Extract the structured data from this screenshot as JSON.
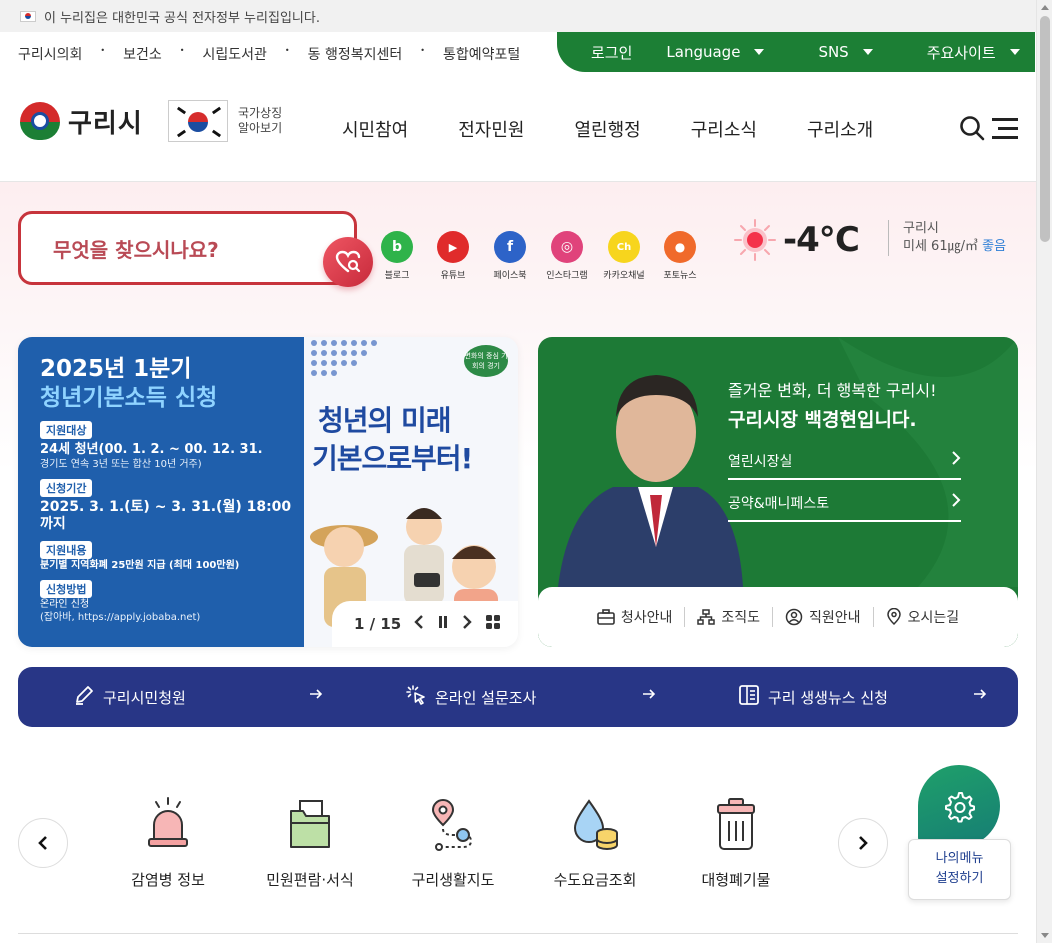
{
  "gov_notice": "이 누리집은 대한민국 공식 전자정부 누리집입니다.",
  "util_links": [
    "구리시의회",
    "보건소",
    "시립도서관",
    "동 행정복지센터",
    "통합예약포털"
  ],
  "util_right": {
    "login": "로그인",
    "language": "Language",
    "sns": "SNS",
    "major_sites": "주요사이트"
  },
  "logo_text": "구리시",
  "national_symbol": "국가상징 알아보기",
  "gnb": [
    "시민참여",
    "전자민원",
    "열린행정",
    "구리소식",
    "구리소개"
  ],
  "search": {
    "placeholder": "무엇을 찾으시나요?"
  },
  "sns_links": [
    {
      "label": "블로그",
      "glyph": "b",
      "color": "#2fb34a"
    },
    {
      "label": "유튜브",
      "glyph": "▶",
      "color": "#e02b2b"
    },
    {
      "label": "페이스북",
      "glyph": "f",
      "color": "#2d63c8"
    },
    {
      "label": "인스타그램",
      "glyph": "◎",
      "color": "#e0437b"
    },
    {
      "label": "카카오채널",
      "glyph": "Ch",
      "color": "#f7d51d"
    },
    {
      "label": "포토뉴스",
      "glyph": "●",
      "color": "#f06a2b"
    }
  ],
  "weather": {
    "temp": "-4℃",
    "region": "구리시",
    "dust_label": "미세 61㎍/㎥",
    "dust_status": "좋음"
  },
  "banner": {
    "title1": "2025년 1분기",
    "title2": "청년기본소득 신청",
    "tag1": "지원대상",
    "target": "24세 청년(00. 1. 2. ~ 00. 12. 31.",
    "target_sub": "경기도 연속 3년 또는 합산 10년 거주)",
    "tag2": "신청기간",
    "period": "2025. 3. 1.(토) ~ 3. 31.(월) 18:00까지",
    "tag3": "지원내용",
    "content": "분기별 지역화폐 25만원 지급 (최대 100만원)",
    "tag4": "신청방법",
    "method": "온라인 신청",
    "method_sub": "(잡아바, https://apply.jobaba.net)",
    "slogan1": "청년의 미래",
    "slogan2": "기본으로부터!",
    "badge": "변화의 중심 기회의 경기",
    "counter": "1 / 15"
  },
  "mayor": {
    "intro": "즐거운 변화, 더 행복한 구리시!",
    "name": "구리시장 백경현입니다.",
    "link1": "열린시장실",
    "link2": "공약&매니페스토",
    "bottom": [
      "청사안내",
      "조직도",
      "직원안내",
      "오시는길"
    ]
  },
  "quickbar": [
    "구리시민청원",
    "온라인 설문조사",
    "구리 생생뉴스 신청"
  ],
  "services": [
    "감염병 정보",
    "민원편람·서식",
    "구리생활지도",
    "수도요금조회",
    "대형폐기물"
  ],
  "my_menu": {
    "line1": "나의메뉴",
    "line2": "설정하기"
  }
}
